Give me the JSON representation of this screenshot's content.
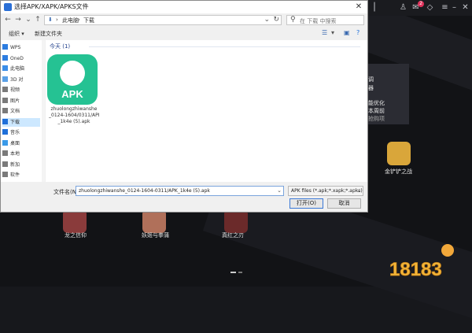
{
  "dialog": {
    "title": "选择APK/XAPK/APKS文件",
    "close_glyph": "✕",
    "breadcrumb": [
      "此电脑",
      "下载"
    ],
    "search_placeholder": "在 下载 中搜索",
    "toolbar": {
      "organize": "组织 ▾",
      "new_folder": "新建文件夹"
    },
    "group_label": "今天 (1)",
    "file": {
      "icon_text": "APK",
      "name_lines": [
        "zhuolongzhiwanshe",
        "_0124-1604/0311/APK",
        "_1k4e (5).apk"
      ]
    },
    "filename_label": "文件名(N):",
    "filename_value": "zhuolongzhiwanshe_0124-1604-0311/APK_1k4e (5).apk",
    "filetype_value": "APK files (*.apk;*.xapk;*.apks)",
    "open_button": "打开(O)",
    "cancel_button": "取消"
  },
  "nav_items": [
    {
      "label": "WPS",
      "icon_color": "#2d7de0"
    },
    {
      "label": "OneD",
      "icon_color": "#2d7de0"
    },
    {
      "label": "此电脑",
      "icon_color": "#3a8de8"
    },
    {
      "label": "3D 对",
      "icon_color": "#5aa0e6"
    },
    {
      "label": "视频",
      "icon_color": "#7a7a7a"
    },
    {
      "label": "图片",
      "icon_color": "#7a7a7a"
    },
    {
      "label": "文档",
      "icon_color": "#7a7a7a"
    },
    {
      "label": "下载",
      "icon_color": "#1e6fd9",
      "selected": true
    },
    {
      "label": "音乐",
      "icon_color": "#1e6fd9"
    },
    {
      "label": "桌面",
      "icon_color": "#3a9ae8"
    },
    {
      "label": "本地",
      "icon_color": "#7a7a7a"
    },
    {
      "label": "新加",
      "icon_color": "#7a7a7a"
    },
    {
      "label": "软件",
      "icon_color": "#7a7a7a"
    }
  ],
  "emulator": {
    "notification_count": "2",
    "popup_lines": [
      "调",
      "器",
      "能优化",
      "本周前",
      "抢购项"
    ],
    "games": [
      {
        "name": "金铲铲之战",
        "color": "#d9a63a"
      },
      {
        "name": "龙之信仰",
        "color": "#8a3b3b"
      },
      {
        "name": "妖姬与拳蒲",
        "color": "#b0705a"
      },
      {
        "name": "真红之刃",
        "color": "#6b2a2a"
      }
    ],
    "watermark": "18183"
  }
}
